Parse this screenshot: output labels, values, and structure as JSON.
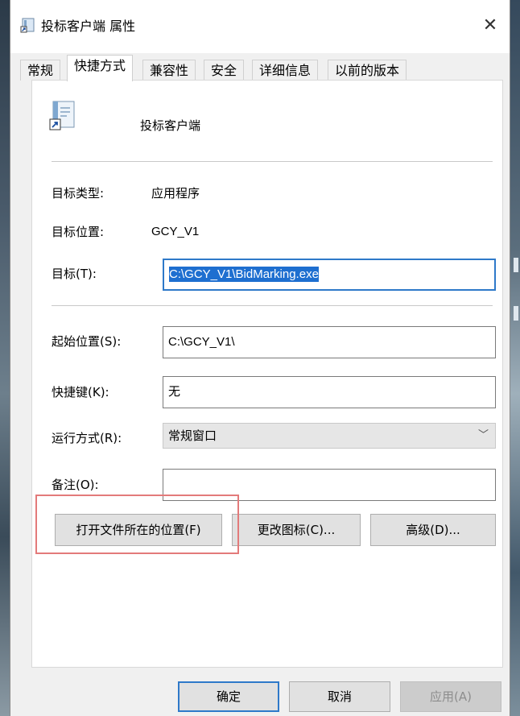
{
  "window": {
    "title": "投标客户端 属性"
  },
  "tabs": [
    {
      "label": "常规"
    },
    {
      "label": "快捷方式",
      "active": true
    },
    {
      "label": "兼容性"
    },
    {
      "label": "安全"
    },
    {
      "label": "详细信息"
    },
    {
      "label": "以前的版本"
    }
  ],
  "shortcut": {
    "name": "投标客户端",
    "target_type_label": "目标类型:",
    "target_type_value": "应用程序",
    "target_location_label": "目标位置:",
    "target_location_value": "GCY_V1",
    "target_label": "目标(T):",
    "target_value": "C:\\GCY_V1\\BidMarking.exe",
    "start_in_label": "起始位置(S):",
    "start_in_value": "C:\\GCY_V1\\",
    "hotkey_label": "快捷键(K):",
    "hotkey_value": "无",
    "run_label": "运行方式(R):",
    "run_value": "常规窗口",
    "comment_label": "备注(O):",
    "comment_value": ""
  },
  "buttons": {
    "open_location": "打开文件所在的位置(F)",
    "change_icon": "更改图标(C)...",
    "advanced": "高级(D)...",
    "ok": "确定",
    "cancel": "取消",
    "apply": "应用(A)"
  },
  "icons": {
    "title": "shortcut-file-icon",
    "close": "close-icon",
    "app": "document-shortcut-icon",
    "dropdown": "chevron-down-icon"
  },
  "colors": {
    "highlight": "#1e6fd0",
    "focus_border": "#2e79c9",
    "annotation": "#e37a7a"
  }
}
